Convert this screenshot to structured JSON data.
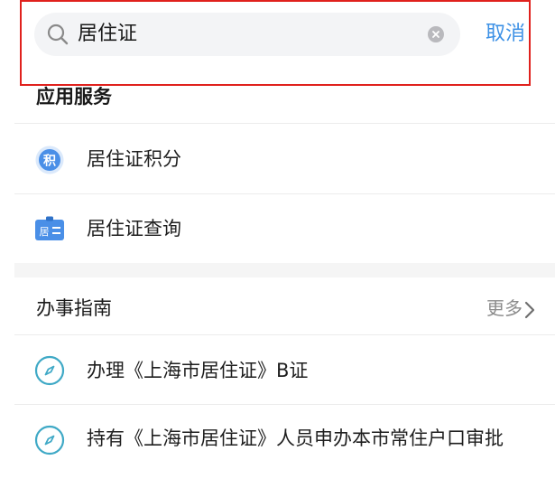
{
  "search": {
    "query": "居住证",
    "cancel_label": "取消"
  },
  "app_services": {
    "title": "应用服务",
    "items": [
      {
        "label": "居住证积分",
        "icon": "points-badge-icon",
        "icon_text": "积"
      },
      {
        "label": "居住证查询",
        "icon": "residence-card-icon",
        "icon_text": "居"
      }
    ]
  },
  "guide": {
    "title": "办事指南",
    "more_label": "更多",
    "items": [
      {
        "label": "办理《上海市居住证》B证",
        "icon": "compass-icon"
      },
      {
        "label": "持有《上海市居住证》人员申办本市常住户口审批",
        "icon": "compass-icon"
      }
    ]
  },
  "colors": {
    "accent": "#3d91e6",
    "highlight_outline": "#e0211d",
    "search_bg": "#f3f4f6",
    "section_gap": "#f5f5f5"
  }
}
